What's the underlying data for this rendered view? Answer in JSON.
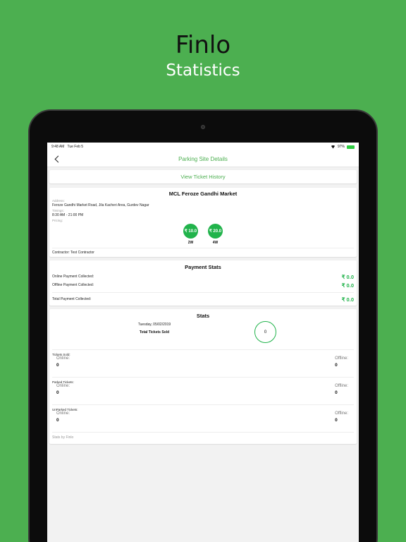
{
  "promo": {
    "title": "Finlo",
    "subtitle": "Statistics"
  },
  "status_bar": {
    "time": "9:48 AM",
    "date": "Tue Feb 5",
    "battery": "97%"
  },
  "nav": {
    "title": "Parking Site Details"
  },
  "history_button": "View Ticket History",
  "site": {
    "name": "MCL Feroze Gandhi Market",
    "address_label": "Address:",
    "address": "Feroze Gandhi Market Road, Jila Kacheri Area, Gurdev Nagar",
    "timings_label": "Timings:",
    "timings": "8:30 AM - 21:00 PM",
    "pricing_label": "Pricing:",
    "prices": [
      {
        "amount": "₹ 10.0",
        "type": "2W"
      },
      {
        "amount": "₹ 20.0",
        "type": "4W"
      }
    ],
    "contractor": "Contractor: Test Contractor"
  },
  "payment": {
    "title": "Payment Stats",
    "rows": [
      {
        "label": "Online Payment Collected:",
        "amount": "₹ 0.0"
      },
      {
        "label": "Offline Payment Collected:",
        "amount": "₹ 0.0"
      }
    ],
    "total_label": "Total Payment Collected:",
    "total_amount": "₹ 0.0"
  },
  "stats": {
    "title": "Stats",
    "date": "Tuesday, 05/02/2019",
    "total_label": "Total Tickets Sold",
    "total_value": "0",
    "blocks": [
      {
        "heading": "Tickets Sold:",
        "online_label": "Online:",
        "online": "0",
        "offline_label": "Offline:",
        "offline": "0"
      },
      {
        "heading": "Parked Tickets:",
        "online_label": "Online:",
        "online": "0",
        "offline_label": "Offline:",
        "offline": "0"
      },
      {
        "heading": "UnParked Tickets:",
        "online_label": "Online:",
        "online": "0",
        "offline_label": "Offline:",
        "offline": "0"
      }
    ],
    "footer": "Stats by Finlo"
  },
  "colors": {
    "brand_green": "#4caf50",
    "accent_green": "#21b34b"
  }
}
